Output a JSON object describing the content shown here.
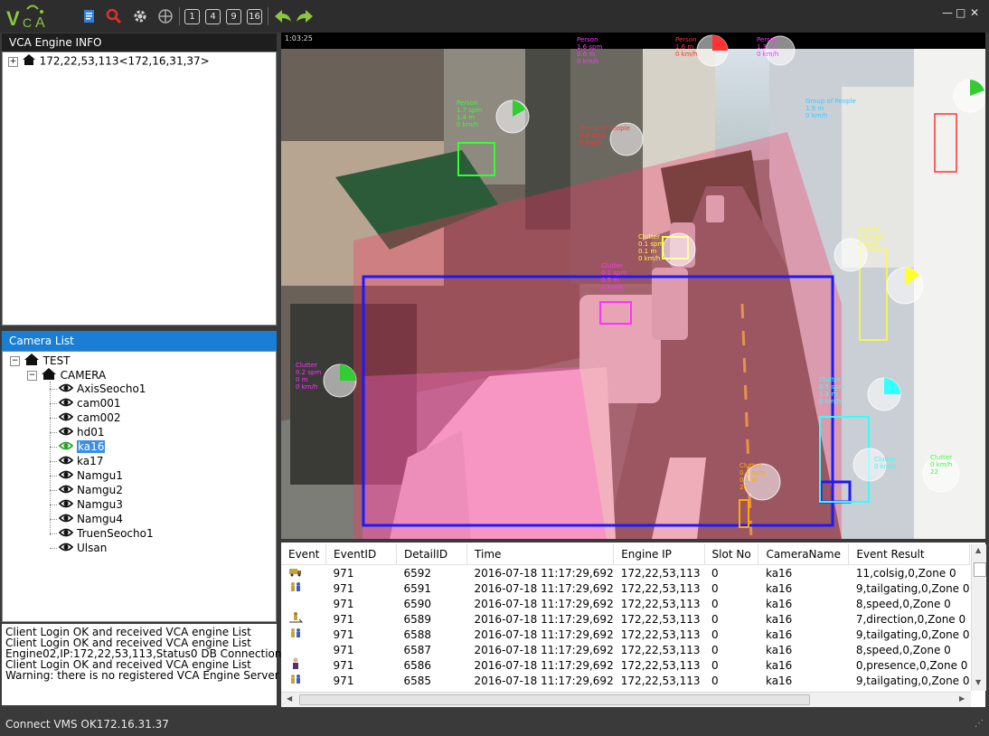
{
  "app": {
    "logo_text": "VCA",
    "window_controls": [
      "—",
      "□",
      "✕"
    ]
  },
  "toolbar": {
    "layout_buttons": [
      "1",
      "4",
      "9",
      "16"
    ]
  },
  "engine_panel": {
    "title": "VCA Engine  INFO",
    "engine_node": "172,22,53,113<172,16,31,37>"
  },
  "camera_panel": {
    "title": "Camera List",
    "root": "TEST",
    "group": "CAMERA",
    "cameras": [
      "AxisSeocho1",
      "cam001",
      "cam002",
      "hd01",
      "ka16",
      "ka17",
      "Namgu1",
      "Namgu2",
      "Namgu3",
      "Namgu4",
      "TruenSeocho1",
      "Ulsan"
    ],
    "selected_camera": "ka16"
  },
  "video": {
    "timestamp": "1:03:25",
    "labels": [
      {
        "text": "Person\n1.7 spm\n1.4 m\n0 km/h",
        "color": "#33ff33"
      },
      {
        "text": "Person\n1.6 spm\n0.6 m\n0 km/h",
        "color": "#ff33ff"
      },
      {
        "text": "Person\n1.6 m\n0 km/h",
        "color": "#ff3333"
      },
      {
        "text": "Person\n1.3 m\n0 km/h",
        "color": "#ff33ff"
      },
      {
        "text": "Group of People\n0.8 spm\n0 km/h",
        "color": "#ff3333"
      },
      {
        "text": "Group of People\n1.9 m\n0 km/h",
        "color": "#33ccff"
      },
      {
        "text": "Clutter\n0.1 spm\n0.1 m\n0 km/h",
        "color": "#ffff33"
      },
      {
        "text": "Clutter\n0.1 spm\n0.5 m\n0 km/h",
        "color": "#ff33ff"
      },
      {
        "text": "Clutter\n0.2 spm\n0 m\n0 km/h",
        "color": "#ff33ff"
      },
      {
        "text": "Clutter\n0.5 spm\n1.9 m\n0 km/h",
        "color": "#33ffff"
      },
      {
        "text": "Clutter\n0.1 spm\n0.1 m\n20",
        "color": "#ffaa00"
      },
      {
        "text": "Clutter\n0 km/h",
        "color": "#33ffff"
      },
      {
        "text": "Clutter\n0 km/h\n22",
        "color": "#33ff33"
      },
      {
        "text": "Clutter\n0.5 spm\n0 km/h",
        "color": "#ffff33"
      }
    ]
  },
  "events": {
    "columns": [
      "Event",
      "EventID",
      "DetailID",
      "Time",
      "Engine IP",
      "Slot No",
      "CameraName",
      "Event Result"
    ],
    "rows": [
      {
        "icon": "truck-icon",
        "event_id": "971",
        "detail_id": "6592",
        "time": "2016-07-18 11:17:29,692",
        "ip": "172,22,53,113",
        "slot": "0",
        "camera": "ka16",
        "result": "11,colsig,0,Zone 0"
      },
      {
        "icon": "people-icon",
        "event_id": "971",
        "detail_id": "6591",
        "time": "2016-07-18 11:17:29,692",
        "ip": "172,22,53,113",
        "slot": "0",
        "camera": "ka16",
        "result": "9,tailgating,0,Zone 0"
      },
      {
        "icon": "",
        "event_id": "971",
        "detail_id": "6590",
        "time": "2016-07-18 11:17:29,692",
        "ip": "172,22,53,113",
        "slot": "0",
        "camera": "ka16",
        "result": "8,speed,0,Zone 0"
      },
      {
        "icon": "direction-icon",
        "event_id": "971",
        "detail_id": "6589",
        "time": "2016-07-18 11:17:29,692",
        "ip": "172,22,53,113",
        "slot": "0",
        "camera": "ka16",
        "result": "7,direction,0,Zone 0"
      },
      {
        "icon": "people-icon",
        "event_id": "971",
        "detail_id": "6588",
        "time": "2016-07-18 11:17:29,692",
        "ip": "172,22,53,113",
        "slot": "0",
        "camera": "ka16",
        "result": "9,tailgating,0,Zone 0"
      },
      {
        "icon": "",
        "event_id": "971",
        "detail_id": "6587",
        "time": "2016-07-18 11:17:29,692",
        "ip": "172,22,53,113",
        "slot": "0",
        "camera": "ka16",
        "result": "8,speed,0,Zone 0"
      },
      {
        "icon": "person-icon",
        "event_id": "971",
        "detail_id": "6586",
        "time": "2016-07-18 11:17:29,692",
        "ip": "172,22,53,113",
        "slot": "0",
        "camera": "ka16",
        "result": "0,presence,0,Zone 0"
      },
      {
        "icon": "people-icon",
        "event_id": "971",
        "detail_id": "6585",
        "time": "2016-07-18 11:17:29,692",
        "ip": "172,22,53,113",
        "slot": "0",
        "camera": "ka16",
        "result": "9,tailgating,0,Zone 0"
      }
    ]
  },
  "log": [
    "Client Login OK and  received VCA engine List",
    "Client Login OK and  received VCA engine List",
    "Engine02,IP:172,22,53,113,Status0 DB Connection OK",
    "Client Login OK and  received VCA engine List",
    "Warning: there is no registered VCA Engine Server"
  ],
  "status": {
    "text": "Connect VMS OK172.16.31.37"
  },
  "colors": {
    "accent": "#1a7fd4",
    "header_dark": "#1e1e1e",
    "zone_blue": "#1a1aff"
  }
}
